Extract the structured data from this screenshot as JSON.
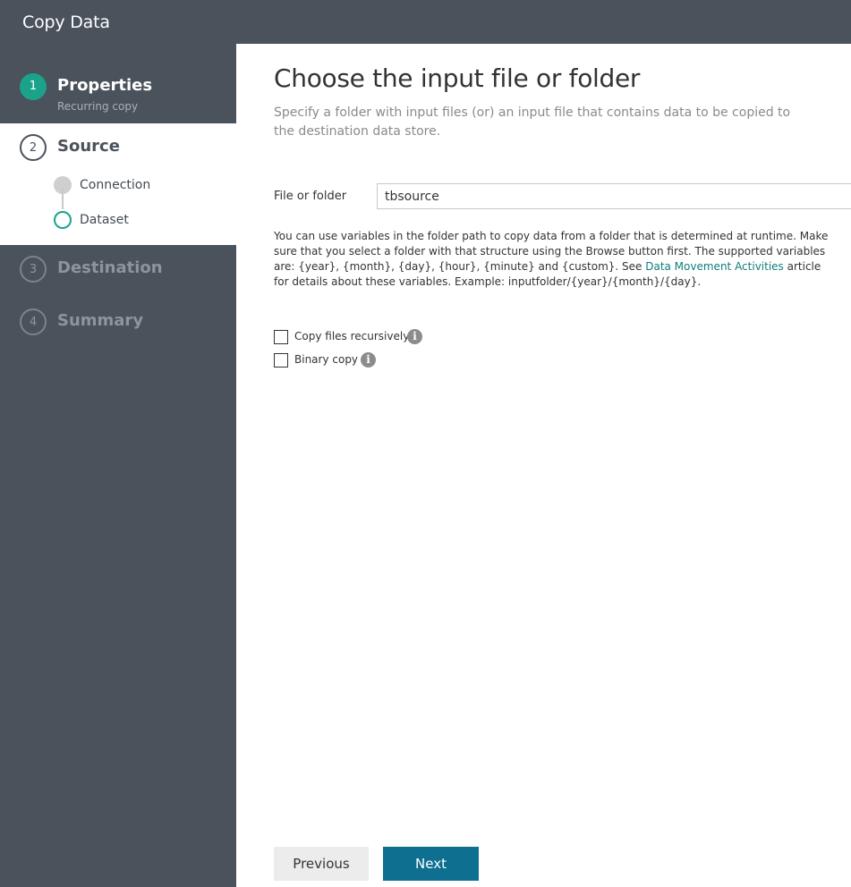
{
  "app": {
    "title": "Copy Data"
  },
  "steps": [
    {
      "number": "1",
      "label": "Properties",
      "sublabel": "Recurring copy",
      "state": "completed"
    },
    {
      "number": "2",
      "label": "Source",
      "state": "active",
      "substeps": [
        {
          "label": "Connection",
          "state": "completed"
        },
        {
          "label": "Dataset",
          "state": "current"
        }
      ]
    },
    {
      "number": "3",
      "label": "Destination",
      "state": "pending"
    },
    {
      "number": "4",
      "label": "Summary",
      "state": "pending"
    }
  ],
  "main": {
    "heading": "Choose the input file or folder",
    "subtitle": "Specify a folder with input files (or) an input file that contains data to be copied to the destination data store.",
    "file_field": {
      "label": "File or folder",
      "value": "tbsource"
    },
    "help": {
      "before_link": "You can use variables in the folder path to copy data from a folder that is determined at runtime. Make sure that you select a folder with that structure using the Browse button first. The supported variables are: {year}, {month}, {day}, {hour}, {minute} and {custom}. See ",
      "link": "Data Movement Activities",
      "after_link": " article for details about these variables. Example: inputfolder/{year}/{month}/{day}."
    },
    "options": [
      {
        "label": "Copy files recursively",
        "checked": false
      },
      {
        "label": "Binary copy",
        "checked": false
      }
    ]
  },
  "buttons": {
    "previous": "Previous",
    "next": "Next"
  },
  "colors": {
    "sidebar_bg": "#4a525c",
    "accent_teal": "#1aa38a",
    "primary_button": "#0e6f91",
    "link": "#107c7c"
  },
  "icons": {
    "info": "info-icon",
    "step_done": "filled-circle",
    "step_current": "hollow-circle"
  }
}
